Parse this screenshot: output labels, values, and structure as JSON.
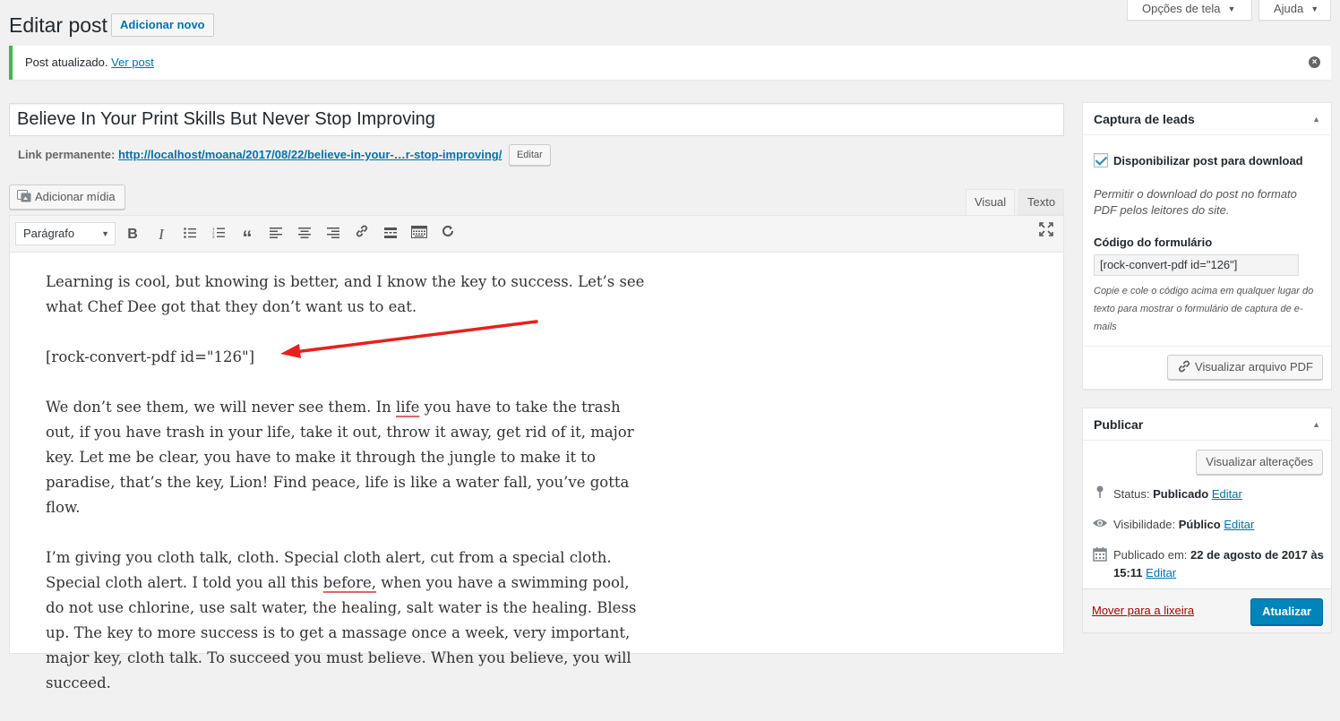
{
  "screen_tabs": {
    "screen_options": "Opções de tela",
    "help": "Ajuda"
  },
  "header": {
    "title": "Editar post",
    "add_new": "Adicionar novo"
  },
  "notice": {
    "text": "Post atualizado.",
    "link": "Ver post"
  },
  "post": {
    "title": "Believe In Your Print Skills But Never Stop Improving",
    "permalink_label": "Link permanente:",
    "permalink_url": "http://localhost/moana/2017/08/22/believe-in-your-…r-stop-improving/",
    "permalink_edit": "Editar"
  },
  "editor": {
    "add_media": "Adicionar mídia",
    "tab_visual": "Visual",
    "tab_text": "Texto",
    "format": "Parágrafo",
    "paragraphs": {
      "p1": "Learning is cool, but knowing is better, and I know the key to success. Let’s see what Chef Dee got that they don’t want us to eat.",
      "p2": "[rock-convert-pdf id=\"126\"]",
      "p3a": "We don’t see them, we will never see them. In ",
      "p3b": "life",
      "p3c": " you have to take the trash out, if you have trash in your life, take it out, throw it away, get rid of it, major key. Let me be clear, you have to make it through the jungle to make it to paradise, that’s the key, Lion! Find peace, life is like a water fall, you’ve gotta flow.",
      "p4a": "I’m giving you cloth talk, cloth. Special cloth alert, cut from a special cloth. Special cloth alert. I told you all this ",
      "p4b": "before,",
      "p4c": " when you have a swimming pool, do not use chlorine, use salt water, the healing, salt water is the healing. Bless up. The key to more success is to get a massage once a week, very important, major key, cloth talk. To succeed you must believe. When you believe, you will succeed."
    },
    "annotation_arrow_color": "#e8201c"
  },
  "leads_box": {
    "title": "Captura de leads",
    "checkbox_label": "Disponibilizar post para download",
    "checkbox_checked": true,
    "description": "Permitir o download do post no formato PDF pelos leitores do site.",
    "code_label": "Código do formulário",
    "code_value": "[rock-convert-pdf id=\"126\"]",
    "help": "Copie e cole o código acima em qualquer lugar do texto para mostrar o formulário de captura de e-mails",
    "preview_button": "Visualizar arquivo PDF"
  },
  "publish_box": {
    "title": "Publicar",
    "preview_changes": "Visualizar alterações",
    "status_label": "Status:",
    "status_value": "Publicado",
    "visibility_label": "Visibilidade:",
    "visibility_value": "Público",
    "published_label": "Publicado em:",
    "published_value": "22 de agosto de 2017 às 15:11",
    "edit": "Editar",
    "trash": "Mover para a lixeira",
    "update": "Atualizar"
  },
  "colors": {
    "primary": "#0085ba",
    "notice_success": "#46b450",
    "link": "#0073aa",
    "trash": "#a00"
  }
}
